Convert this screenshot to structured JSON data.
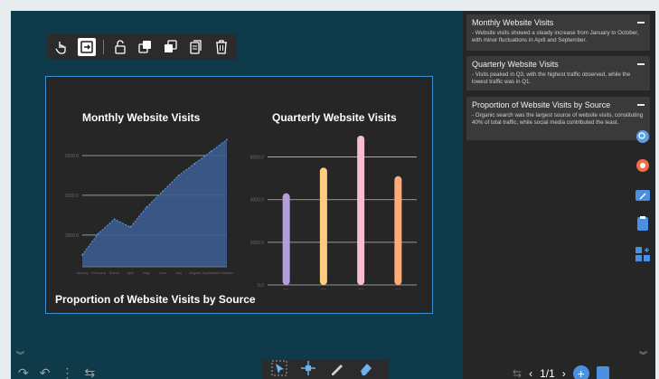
{
  "toolbar": {
    "tools": [
      {
        "icon": "hand-pointer-icon",
        "label": ""
      },
      {
        "icon": "exit-icon",
        "label": ""
      },
      {
        "icon": "unlock-icon",
        "label": ""
      },
      {
        "icon": "bring-forward-icon",
        "label": ""
      },
      {
        "icon": "send-backward-icon",
        "label": ""
      },
      {
        "icon": "copy-icon",
        "label": ""
      },
      {
        "icon": "trash-icon",
        "label": ""
      }
    ]
  },
  "slide": {
    "monthly_title": "Monthly Website Visits",
    "quarterly_title": "Quarterly Website Visits",
    "section_title": "Proportion of Website Visits by Source"
  },
  "chart_data": [
    {
      "type": "area",
      "title": "Monthly Website Visits",
      "categories": [
        "January",
        "February",
        "March",
        "April",
        "May",
        "June",
        "July",
        "August",
        "September",
        "October"
      ],
      "values": [
        1250,
        1520,
        1700,
        1600,
        1850,
        2050,
        2250,
        2400,
        2550,
        2700
      ],
      "yticks": [
        "1500.0",
        "2000.0",
        "2500.0"
      ],
      "ylim": [
        1100,
        2750
      ],
      "grid": true
    },
    {
      "type": "bar",
      "title": "Quarterly Website Visits",
      "categories": [
        "Q1",
        "Q2",
        "Q3",
        "Q4"
      ],
      "values": [
        4300,
        5500,
        7000,
        5100
      ],
      "colors": [
        "#b39ddb",
        "#ffcc80",
        "#f8bbd0",
        "#ffab76"
      ],
      "yticks": [
        "0.0",
        "2000.0",
        "4000.0",
        "6000.0"
      ],
      "ylim": [
        0,
        7000
      ],
      "grid": true
    }
  ],
  "notes": [
    {
      "title": "Monthly Website Visits",
      "body": "- Website visits showed a steady increase from January to October, with minor fluctuations in April and September."
    },
    {
      "title": "Quarterly Website Visits",
      "body": "- Visits peaked in Q3, with the highest traffic observed, while the lowest traffic was in Q1."
    },
    {
      "title": "Proportion of Website Visits by Source",
      "body": "- Organic search was the largest source of website visits, constituting 40% of total traffic, while social media contributed the least."
    }
  ],
  "pager": {
    "current": "1/1"
  },
  "side_tools": [
    {
      "icon": "search-cloud-icon",
      "color": "#5aa0e6"
    },
    {
      "icon": "record-icon",
      "color": "#f06b4a"
    },
    {
      "icon": "screen-cast-icon",
      "color": "#4a90e2"
    },
    {
      "icon": "clipboard-icon",
      "color": "#4a90e2"
    },
    {
      "icon": "apps-icon",
      "color": "#4a90e2"
    }
  ]
}
